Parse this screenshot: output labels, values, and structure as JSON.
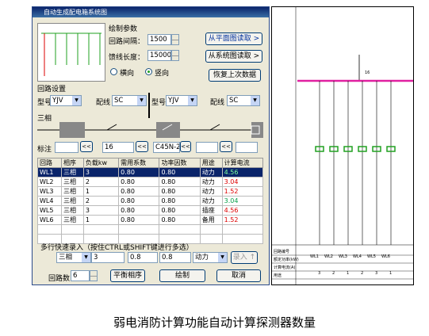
{
  "window": {
    "title": "自动生成配电箱系统图"
  },
  "draw_params": {
    "heading": "绘制参数",
    "loop_spacing_label": "回路间隔：",
    "loop_spacing": "1500",
    "feeder_length_label": "馈线长度：",
    "feeder_length": "15000",
    "radio_horizontal": "横向",
    "radio_vertical": "竖向",
    "btn_from_plan": "从平面图读取 >",
    "btn_from_system": "从系统图读取 >",
    "btn_restore": "恢复上次数据"
  },
  "loop_settings": {
    "heading": "回路设置",
    "model_label": "型号",
    "model_value": "YJV",
    "conduit_label": "配线",
    "conduit_value": "SC",
    "model_value2": "YJV",
    "conduit_value2": "SC",
    "phase_label": "三相",
    "note_label": "标注",
    "note_value1": "16",
    "note_value2": "C45N-2(",
    "arrow": "<<"
  },
  "table": {
    "headers": [
      "回路",
      "相序",
      "负载kw",
      "需用系数",
      "功率因数",
      "用途",
      "计算电流"
    ],
    "rows": [
      [
        "WL1",
        "三相",
        "3",
        "0.80",
        "0.80",
        "动力",
        "4.56"
      ],
      [
        "WL2",
        "三相",
        "2",
        "0.80",
        "0.80",
        "动力",
        "3.04"
      ],
      [
        "WL3",
        "三相",
        "1",
        "0.80",
        "0.80",
        "动力",
        "1.52"
      ],
      [
        "WL4",
        "三相",
        "2",
        "0.80",
        "0.80",
        "动力",
        "3.04"
      ],
      [
        "WL5",
        "三相",
        "3",
        "0.80",
        "0.80",
        "插座",
        "4.56"
      ],
      [
        "WL6",
        "三相",
        "1",
        "0.80",
        "0.80",
        "备用",
        "1.52"
      ]
    ]
  },
  "quick_entry": {
    "heading": "多行快速录入（按住CTRL或SHIFT键进行多选）",
    "phase": "三相",
    "load": "3",
    "demand": "0.8",
    "pf": "0.8",
    "usage": "动力",
    "btn_enter": "录入 ↑"
  },
  "footer": {
    "loop_count_label": "回路数",
    "loop_count": "6",
    "btn_balance": "平衡相序",
    "btn_draw": "绘制",
    "btn_cancel": "取消"
  },
  "drawing": {
    "bus_label": "16",
    "circuits": [
      "WL1",
      "WL2",
      "WL3",
      "WL4",
      "WL5",
      "WL6"
    ],
    "table_rows": [
      "回路编号",
      "额定功率(kW)",
      "计算电流(A)",
      "用途"
    ],
    "loads": [
      "3",
      "2",
      "1",
      "2",
      "3",
      "1"
    ]
  },
  "caption": "弱电消防计算功能自动计算探测器数量",
  "colors": {
    "accent": "#0a246a",
    "bus": "#e020a0",
    "breaker": "#21a121"
  }
}
